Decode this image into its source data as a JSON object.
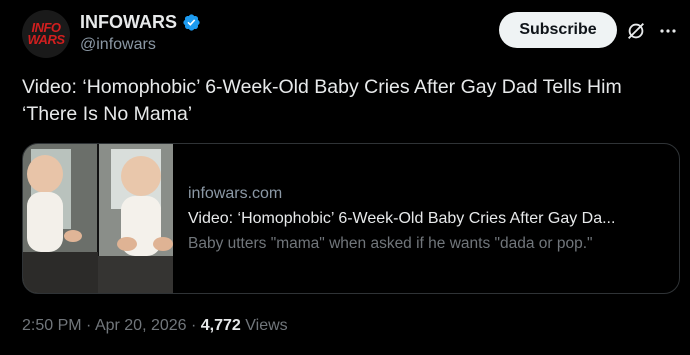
{
  "account": {
    "display_name": "INFOWARS",
    "handle": "@infowars",
    "avatar_text_1": "INFO",
    "avatar_text_2": "WARS"
  },
  "actions": {
    "subscribe_label": "Subscribe"
  },
  "tweet": {
    "text": "Video: ‘Homophobic’ 6-Week-Old Baby Cries After Gay Dad Tells Him ‘There Is No Mama’"
  },
  "card": {
    "domain": "infowars.com",
    "title": "Video: ‘Homophobic’ 6-Week-Old Baby Cries After Gay Da...",
    "description": "Baby utters \"mama\" when asked if he wants \"dada or pop.\""
  },
  "meta": {
    "time": "2:50 PM",
    "separator_1": " · ",
    "date": "Apr 20, 2026",
    "separator_2": " · ",
    "views_count": "4,772",
    "views_label": " Views"
  },
  "colors": {
    "background": "#000000",
    "text": "#e7e9ea",
    "secondary": "#71767b",
    "verified_blue": "#1d9bf0",
    "brand_red": "#d21f1f"
  }
}
